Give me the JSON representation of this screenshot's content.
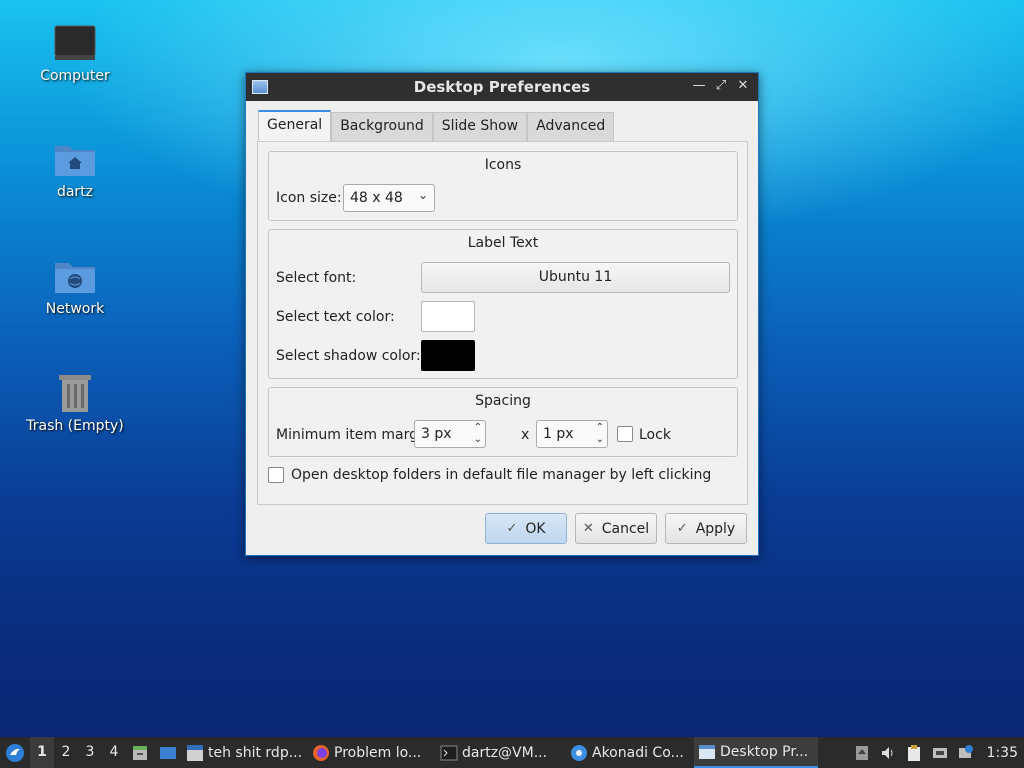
{
  "desktop": {
    "icons": [
      {
        "label": "Computer"
      },
      {
        "label": "dartz"
      },
      {
        "label": "Network"
      },
      {
        "label": "Trash (Empty)"
      }
    ]
  },
  "dialog": {
    "title": "Desktop Preferences",
    "tabs": [
      "General",
      "Background",
      "Slide Show",
      "Advanced"
    ],
    "active_tab": "General",
    "icons_group": {
      "title": "Icons",
      "icon_size_label": "Icon size:",
      "icon_size_value": "48 x 48"
    },
    "label_text_group": {
      "title": "Label Text",
      "font_label": "Select font:",
      "font_value": "Ubuntu 11",
      "text_color_label": "Select text color:",
      "text_color": "#ffffff",
      "shadow_color_label": "Select shadow color:",
      "shadow_color": "#000000"
    },
    "spacing_group": {
      "title": "Spacing",
      "margins_label": "Minimum item margins:",
      "margin_x": "3 px",
      "times": "x",
      "margin_y": "1 px",
      "lock_label": "Lock",
      "lock_checked": false
    },
    "open_folders_label": "Open desktop folders in default file manager by left clicking",
    "open_folders_checked": false,
    "buttons": {
      "ok": "OK",
      "cancel": "Cancel",
      "apply": "Apply"
    }
  },
  "taskbar": {
    "workspaces": [
      "1",
      "2",
      "3",
      "4"
    ],
    "active_workspace": "1",
    "tasks": [
      {
        "label": "teh shit rdp..."
      },
      {
        "label": "Problem lo..."
      },
      {
        "label": "dartz@VM..."
      },
      {
        "label": "Akonadi Co..."
      },
      {
        "label": "Desktop Pr..."
      }
    ],
    "clock": "1:35"
  },
  "colors": {
    "accent": "#3d8ee5",
    "titlebar": "#2f2f2f",
    "taskbar": "#2b2b2b"
  }
}
